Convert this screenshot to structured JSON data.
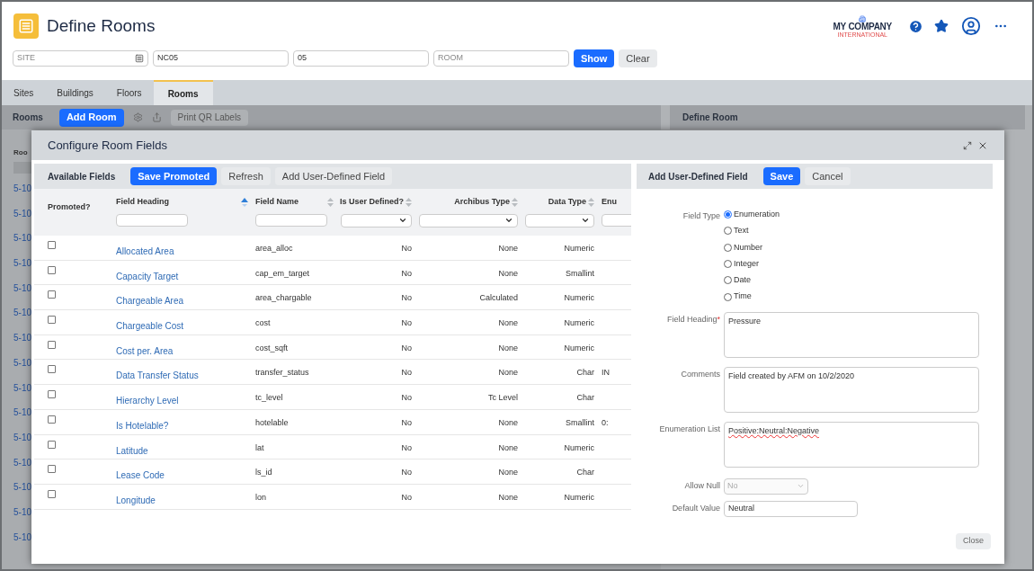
{
  "header": {
    "title": "Define Rooms",
    "logo": {
      "name": "MY COMPANY",
      "tagline": "INTERNATIONAL"
    }
  },
  "filters": [
    {
      "placeholder": "SITE",
      "lookup": true
    },
    {
      "value": "NC05"
    },
    {
      "value": "05"
    },
    {
      "placeholder": "ROOM"
    }
  ],
  "filter_buttons": [
    {
      "label": "Show",
      "primary": true
    },
    {
      "label": "Clear",
      "primary": false
    }
  ],
  "tabs": [
    {
      "label": "Sites",
      "selected": false
    },
    {
      "label": "Buildings",
      "selected": false
    },
    {
      "label": "Floors",
      "selected": false
    },
    {
      "label": "Rooms",
      "selected": true
    }
  ],
  "rooms_panel": {
    "title": "Rooms",
    "add_button": "Add Room",
    "print_button": "Print QR Labels",
    "column_heading": "Roo",
    "rows": [
      "5-10",
      "5-10",
      "5-10",
      "5-10",
      "5-10",
      "5-10",
      "5-10",
      "5-10",
      "5-10",
      "5-10",
      "5-10",
      "5-10",
      "5-10",
      "5-10",
      "5-10"
    ]
  },
  "define_panel": {
    "title": "Define Room"
  },
  "dialog": {
    "title": "Configure Room Fields",
    "fields_panel": {
      "title": "Available Fields",
      "buttons": [
        {
          "label": "Save Promoted",
          "primary": true
        },
        {
          "label": "Refresh",
          "primary": false
        },
        {
          "label": "Add User-Defined Field",
          "primary": false
        }
      ],
      "columns": [
        {
          "label": "Promoted?",
          "kind": "plain"
        },
        {
          "label": "Field Heading",
          "kind": "text",
          "sorted": true
        },
        {
          "label": "Field Name",
          "kind": "text",
          "sorted": false
        },
        {
          "label": "Is User Defined?",
          "kind": "select",
          "sorted": false
        },
        {
          "label": "Archibus Type",
          "kind": "select",
          "sorted": false
        },
        {
          "label": "Data Type",
          "kind": "select",
          "sorted": false
        },
        {
          "label": "Enu",
          "kind": "text"
        }
      ],
      "rows": [
        {
          "checked": false,
          "heading": "Allocated Area",
          "name": "area_alloc",
          "user_defined": "No",
          "archibus_type": "None",
          "data_type": "Numeric"
        },
        {
          "checked": false,
          "heading": "Capacity Target",
          "name": "cap_em_target",
          "user_defined": "No",
          "archibus_type": "None",
          "data_type": "Smallint"
        },
        {
          "checked": false,
          "heading": "Chargeable Area",
          "name": "area_chargable",
          "user_defined": "No",
          "archibus_type": "Calculated",
          "data_type": "Numeric"
        },
        {
          "checked": false,
          "heading": "Chargeable Cost",
          "name": "cost",
          "user_defined": "No",
          "archibus_type": "None",
          "data_type": "Numeric"
        },
        {
          "checked": false,
          "heading": "Cost per. Area",
          "name": "cost_sqft",
          "user_defined": "No",
          "archibus_type": "None",
          "data_type": "Numeric"
        },
        {
          "checked": false,
          "heading": "Data Transfer Status",
          "name": "transfer_status",
          "user_defined": "No",
          "archibus_type": "None",
          "data_type": "Char",
          "column_6": "IN"
        },
        {
          "checked": false,
          "heading": "Hierarchy Level",
          "name": "tc_level",
          "user_defined": "No",
          "archibus_type": "Tc Level",
          "data_type": "Char"
        },
        {
          "checked": false,
          "heading": "Is Hotelable?",
          "name": "hotelable",
          "user_defined": "No",
          "archibus_type": "None",
          "data_type": "Smallint",
          "column_6": "0:"
        },
        {
          "checked": false,
          "heading": "Latitude",
          "name": "lat",
          "user_defined": "No",
          "archibus_type": "None",
          "data_type": "Numeric"
        },
        {
          "checked": false,
          "heading": "Lease Code",
          "name": "ls_id",
          "user_defined": "No",
          "archibus_type": "None",
          "data_type": "Char"
        },
        {
          "checked": false,
          "heading": "Longitude",
          "name": "lon",
          "user_defined": "No",
          "archibus_type": "None",
          "data_type": "Numeric"
        }
      ]
    },
    "form": {
      "title": "Add User-Defined Field",
      "buttons": [
        {
          "label": "Save",
          "primary": true
        },
        {
          "label": "Cancel",
          "primary": false
        }
      ],
      "field_type": {
        "label": "Field Type",
        "options": [
          {
            "label": "Enumeration",
            "selected": true
          },
          {
            "label": "Text",
            "selected": false
          },
          {
            "label": "Number",
            "selected": false
          },
          {
            "label": "Integer",
            "selected": false
          },
          {
            "label": "Date",
            "selected": false
          },
          {
            "label": "Time",
            "selected": false
          }
        ]
      },
      "areas": [
        {
          "label": "Field Heading",
          "required_mark": "*",
          "value": "Pressure",
          "spellcheck_flag": false
        },
        {
          "label": "Comments",
          "value": "Field created by AFM on 10/2/2020",
          "spellcheck_flag": false
        },
        {
          "label": "Enumeration List",
          "value": "Positive:Neutral:Negative",
          "spellcheck_flag": true
        }
      ],
      "allow_null": {
        "label": "Allow Null",
        "value": "No",
        "disabled": true
      },
      "default_value": {
        "label": "Default Value",
        "value": "Neutral"
      },
      "close_button": "Close"
    }
  }
}
